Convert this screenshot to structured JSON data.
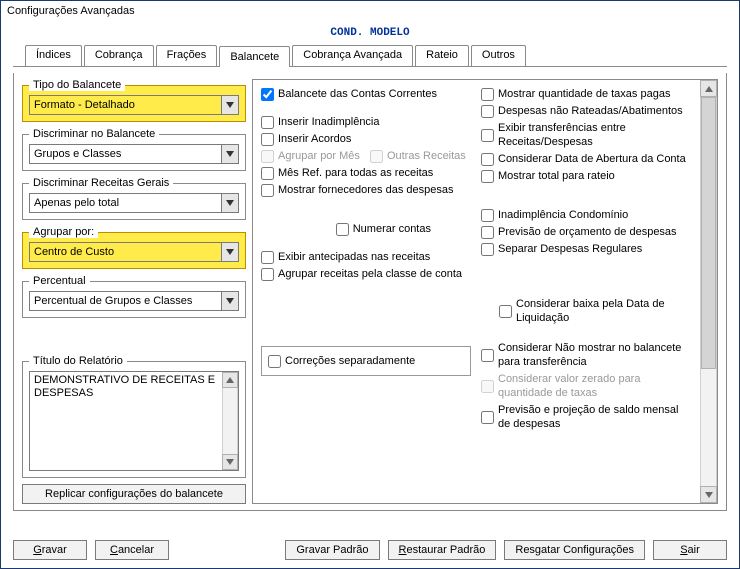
{
  "window_title": "Configurações Avançadas",
  "subtitle": "COND. MODELO",
  "tabs": {
    "indices": "Índices",
    "cobranca": "Cobrança",
    "fracoes": "Frações",
    "balancete": "Balancete",
    "cobranca_av": "Cobrança Avançada",
    "rateio": "Rateio",
    "outros": "Outros"
  },
  "left": {
    "tipo_balancete": {
      "legend": "Tipo do Balancete",
      "value": "Formato - Detalhado"
    },
    "discriminar": {
      "legend": "Discriminar no Balancete",
      "value": "Grupos e Classes"
    },
    "receitas_gerais": {
      "legend": "Discriminar Receitas Gerais",
      "value": "Apenas pelo total"
    },
    "agrupar": {
      "legend": "Agrupar por:",
      "value": "Centro de Custo"
    },
    "percentual": {
      "legend": "Percentual",
      "value": "Percentual de Grupos e Classes"
    },
    "titulo": {
      "legend": "Título do Relatório",
      "value": "DEMONSTRATIVO DE RECEITAS E DESPESAS"
    },
    "replicar": "Replicar configurações do balancete"
  },
  "checks": {
    "balancete_cc": "Balancete das Contas Correntes",
    "inserir_inad": "Inserir Inadimplência",
    "inserir_acordos": "Inserir Acordos",
    "agrupar_mes": "Agrupar por Mês",
    "outras_receitas": "Outras Receitas",
    "mes_ref": "Mês Ref. para todas as receitas",
    "mostrar_forn": "Mostrar fornecedores das despesas",
    "numerar": "Numerar contas",
    "exibir_antecip": "Exibir antecipadas nas receitas",
    "agrupar_classe": "Agrupar receitas pela classe de conta",
    "considerar_baixa": "Considerar baixa pela Data de Liquidação",
    "mostrar_qtd_taxas": "Mostrar quantidade de taxas pagas",
    "desp_nao_rat": "Despesas não Rateadas/Abatimentos",
    "exibir_transf": "Exibir transferências entre Receitas/Despesas",
    "considerar_abertura": "Considerar Data de Abertura da Conta",
    "mostrar_total_rateio": "Mostrar total para rateio",
    "inad_condominio": "Inadimplência Condomínio",
    "previsao_orc": "Previsão de orçamento de despesas",
    "separar_desp": "Separar Despesas Regulares",
    "considerar_nao_mostrar": "Considerar Não mostrar no balancete para transferência",
    "considerar_zero": "Considerar valor zerado para quantidade de taxas",
    "previsao_proj": "Previsão e projeção de saldo mensal de despesas",
    "correcoes_sep": "Correções separadamente"
  },
  "footer": {
    "gravar": "Gravar",
    "cancelar": "Cancelar",
    "gravar_padrao": "Gravar Padrão",
    "restaurar_padrao": "Restaurar Padrão",
    "resgatar": "Resgatar Configurações",
    "sair": "Sair"
  }
}
